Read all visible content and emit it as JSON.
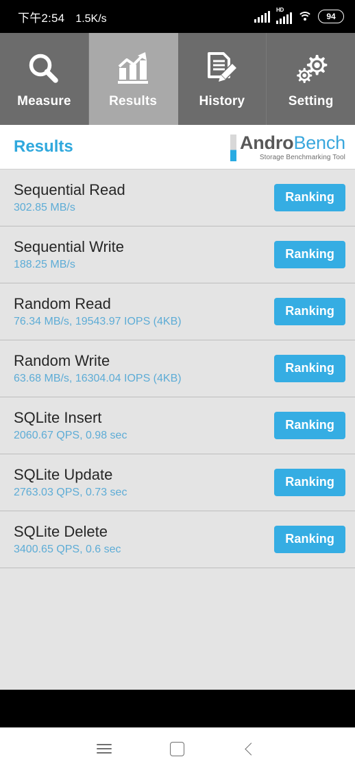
{
  "statusbar": {
    "time": "下午2:54",
    "network_speed": "1.5K/s",
    "hd_label": "HD",
    "battery_level": "94"
  },
  "tabs": [
    {
      "label": "Measure",
      "icon": "magnifier-icon",
      "active": false
    },
    {
      "label": "Results",
      "icon": "bar-chart-trend-icon",
      "active": true
    },
    {
      "label": "History",
      "icon": "document-pencil-icon",
      "active": false
    },
    {
      "label": "Setting",
      "icon": "gears-icon",
      "active": false
    }
  ],
  "header": {
    "page_title": "Results",
    "logo_primary": "Andro",
    "logo_secondary": "Bench",
    "logo_tagline": "Storage Benchmarking Tool"
  },
  "results": {
    "ranking_label": "Ranking",
    "rows": [
      {
        "title": "Sequential Read",
        "value": "302.85 MB/s"
      },
      {
        "title": "Sequential Write",
        "value": "188.25 MB/s"
      },
      {
        "title": "Random Read",
        "value": "76.34 MB/s, 19543.97 IOPS (4KB)"
      },
      {
        "title": "Random Write",
        "value": "63.68 MB/s, 16304.04 IOPS (4KB)"
      },
      {
        "title": "SQLite Insert",
        "value": "2060.67 QPS, 0.98 sec"
      },
      {
        "title": "SQLite Update",
        "value": "2763.03 QPS, 0.73 sec"
      },
      {
        "title": "SQLite Delete",
        "value": "3400.65 QPS, 0.6 sec"
      }
    ]
  },
  "navbar": {
    "recents": "recents-icon",
    "home": "home-icon",
    "back": "back-icon"
  },
  "colors": {
    "accent_blue": "#35ade3",
    "title_blue": "#2fa8dd",
    "value_blue": "#5dacd6",
    "tab_inactive": "#6c6c6c",
    "tab_active": "#a9a9a9",
    "list_bg": "#e4e4e4"
  }
}
